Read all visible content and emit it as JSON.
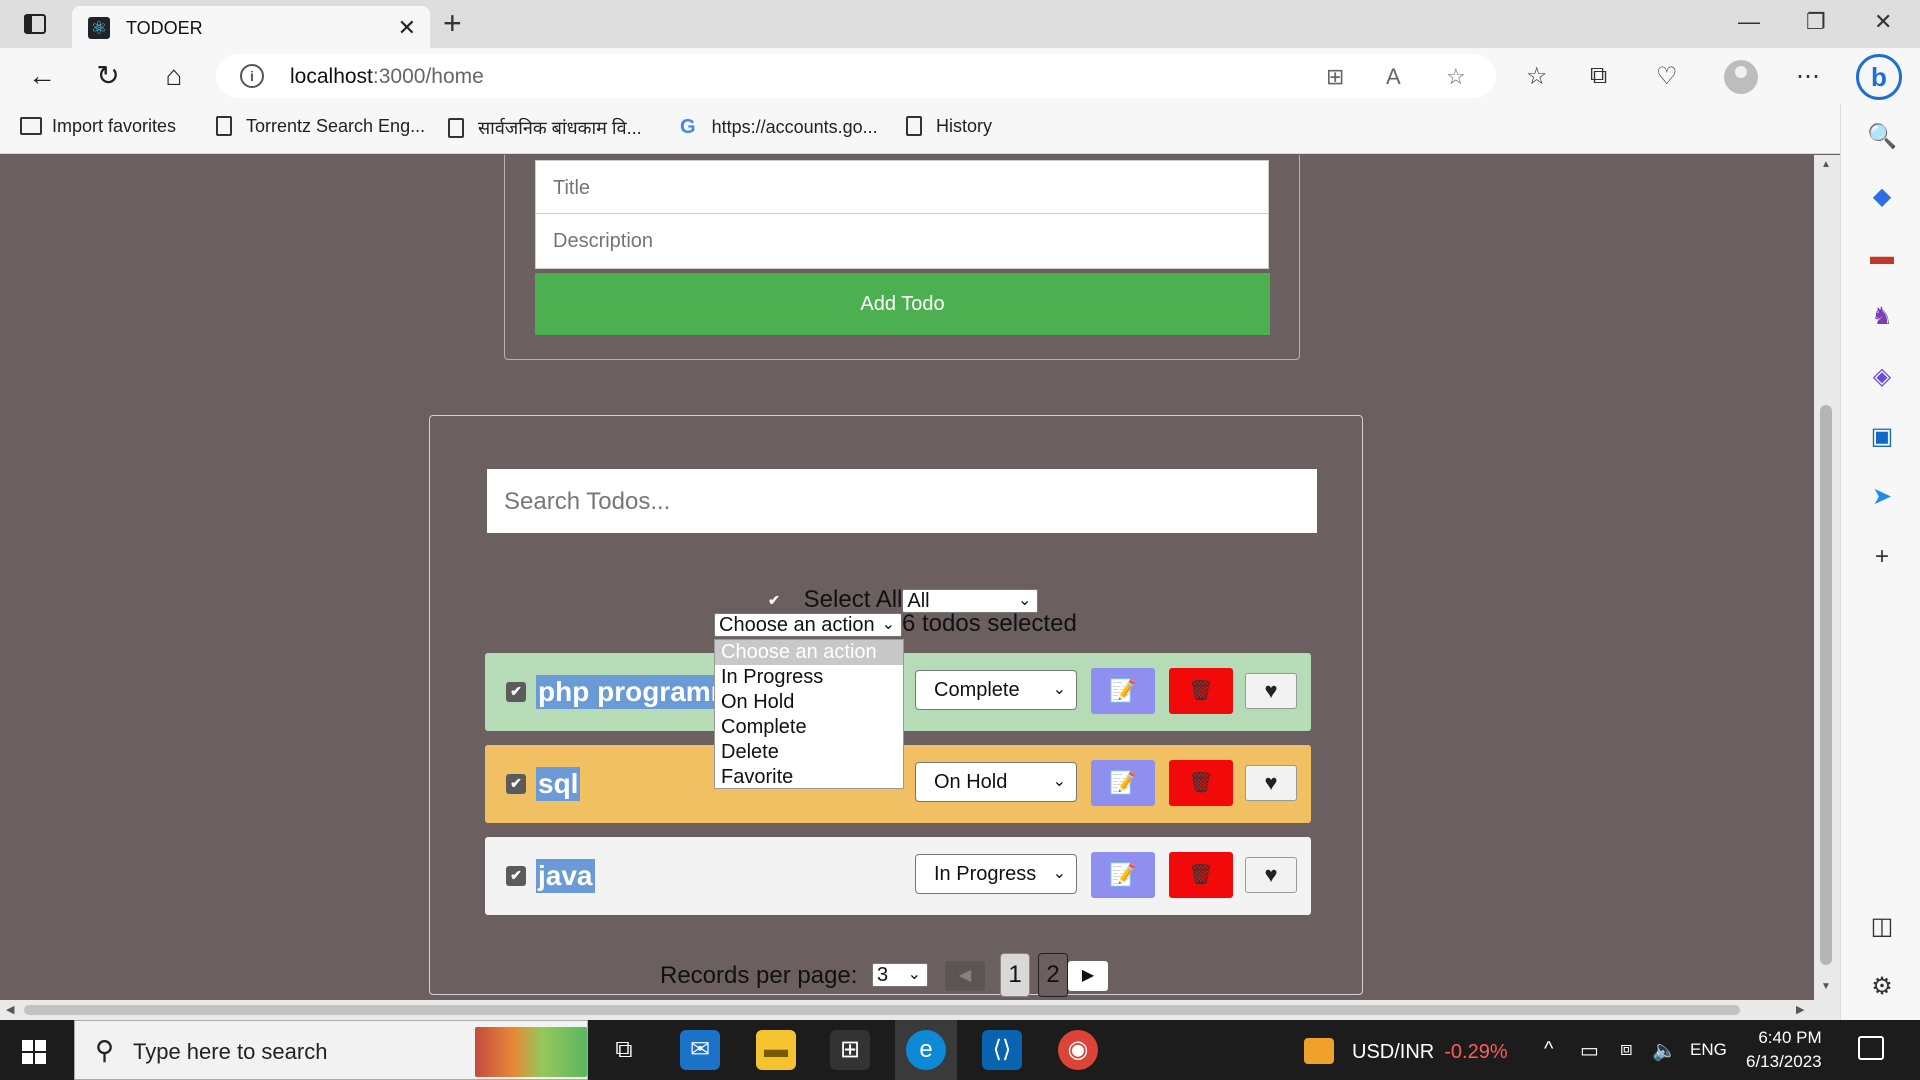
{
  "browser": {
    "tab_title": "TODOER",
    "tab_favicon": "⚛",
    "url_host": "localhost",
    "url_path": ":3000/home",
    "bookmarks": [
      {
        "label": "Import favorites",
        "icon": "import-icon"
      },
      {
        "label": "Torrentz Search Eng...",
        "icon": "page-icon"
      },
      {
        "label": "सार्वजनिक बांधकाम वि...",
        "icon": "page-icon"
      },
      {
        "label": "https://accounts.go...",
        "icon": "google-icon"
      },
      {
        "label": "History",
        "icon": "page-icon"
      }
    ]
  },
  "form": {
    "title_placeholder": "Title",
    "description_placeholder": "Description",
    "add_button": "Add Todo"
  },
  "list": {
    "search_placeholder": "Search Todos...",
    "select_all_label": "Select All",
    "filter_value": "All",
    "action_value": "Choose an action",
    "selected_count_text": "6 todos selected",
    "action_options": [
      "Choose an action",
      "In Progress",
      "On Hold",
      "Complete",
      "Delete",
      "Favorite"
    ],
    "todos": [
      {
        "title": "php programm",
        "status": "Complete",
        "bg": "#b5dbb7",
        "checked": true
      },
      {
        "title": "sql",
        "status": "On Hold",
        "bg": "#f1c062",
        "checked": true
      },
      {
        "title": "java",
        "status": "In Progress",
        "bg": "#f3f3f3",
        "checked": true
      }
    ],
    "records_per_page_label": "Records per page:",
    "records_per_page_value": "3",
    "pages": [
      "1",
      "2"
    ],
    "current_page": "1"
  },
  "taskbar": {
    "search_placeholder": "Type here to search",
    "ticker_label": "USD/INR",
    "ticker_change": "-0.29%",
    "language": "ENG",
    "time": "6:40 PM",
    "date": "6/13/2023"
  },
  "colors": {
    "page_bg": "#6b5f60",
    "add_button": "#4caf50",
    "edit_button": "#8f8fef",
    "delete_button": "#f20a0a",
    "ticker_negative": "#ff5c5c"
  }
}
